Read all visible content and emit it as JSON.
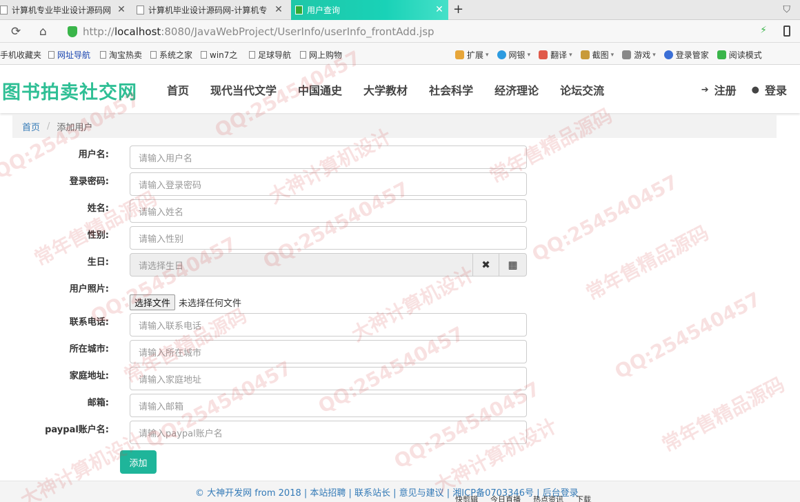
{
  "tabs": [
    {
      "label": "计算机专业毕业设计源码网",
      "close": "✕"
    },
    {
      "label": "计算机毕业设计源码网-计算机专",
      "close": "✕"
    },
    {
      "label": "用户查询",
      "close": "✕"
    }
  ],
  "new_tab": "+",
  "address": {
    "scheme": "http://",
    "host": "localhost",
    "path": ":8080/JavaWebProject/UserInfo/userInfo_frontAdd.jsp"
  },
  "bookmarks": [
    "手机收藏夹",
    "网址导航",
    "淘宝热卖",
    "系统之家",
    "win7之",
    "足球导航",
    "网上购物"
  ],
  "tools": [
    {
      "label": "扩展",
      "color": "#e7a63a"
    },
    {
      "label": "网银",
      "color": "#2d9be0"
    },
    {
      "label": "翻译",
      "color": "#e05a4a"
    },
    {
      "label": "截图",
      "color": "#c89a3a"
    },
    {
      "label": "游戏",
      "color": "#888888"
    },
    {
      "label": "登录管家",
      "color": "#3b6fd6"
    },
    {
      "label": "阅读模式",
      "color": "#3ab54a"
    }
  ],
  "site": {
    "logo": "图书拍卖社交网",
    "nav": [
      "首页",
      "现代当代文学",
      "中国通史",
      "大学教材",
      "社会科学",
      "经济理论",
      "论坛交流"
    ],
    "register": "注册",
    "login": "登录"
  },
  "breadcrumb": {
    "home": "首页",
    "current": "添加用户"
  },
  "form": {
    "username": {
      "label": "用户名:",
      "placeholder": "请输入用户名"
    },
    "password": {
      "label": "登录密码:",
      "placeholder": "请输入登录密码"
    },
    "name": {
      "label": "姓名:",
      "placeholder": "请输入姓名"
    },
    "gender": {
      "label": "性别:",
      "placeholder": "请输入性别"
    },
    "birthday": {
      "label": "生日:",
      "placeholder": "请选择生日"
    },
    "photo": {
      "label": "用户照片:",
      "button": "选择文件",
      "status": "未选择任何文件"
    },
    "phone": {
      "label": "联系电话:",
      "placeholder": "请输入联系电话"
    },
    "city": {
      "label": "所在城市:",
      "placeholder": "请输入所在城市"
    },
    "address": {
      "label": "家庭地址:",
      "placeholder": "请输入家庭地址"
    },
    "email": {
      "label": "邮箱:",
      "placeholder": "请输入邮箱"
    },
    "paypal": {
      "label": "paypal账户名:",
      "placeholder": "请输入paypal账户名"
    },
    "submit": "添加"
  },
  "footer": "© 大神开发网 from 2018 | 本站招聘 | 联系站长 | 意见与建议 | 湘ICP备0703346号 | 后台登录",
  "statusbar": [
    "快剪辑",
    "今日直播",
    "热点资讯",
    "下载"
  ],
  "watermark": [
    "大神计算机设计",
    "QQ:254540457",
    "常年售精品源码"
  ],
  "colors": {
    "accent": "#1fb59a",
    "logo": "#2fbf95",
    "link": "#337ab7"
  }
}
